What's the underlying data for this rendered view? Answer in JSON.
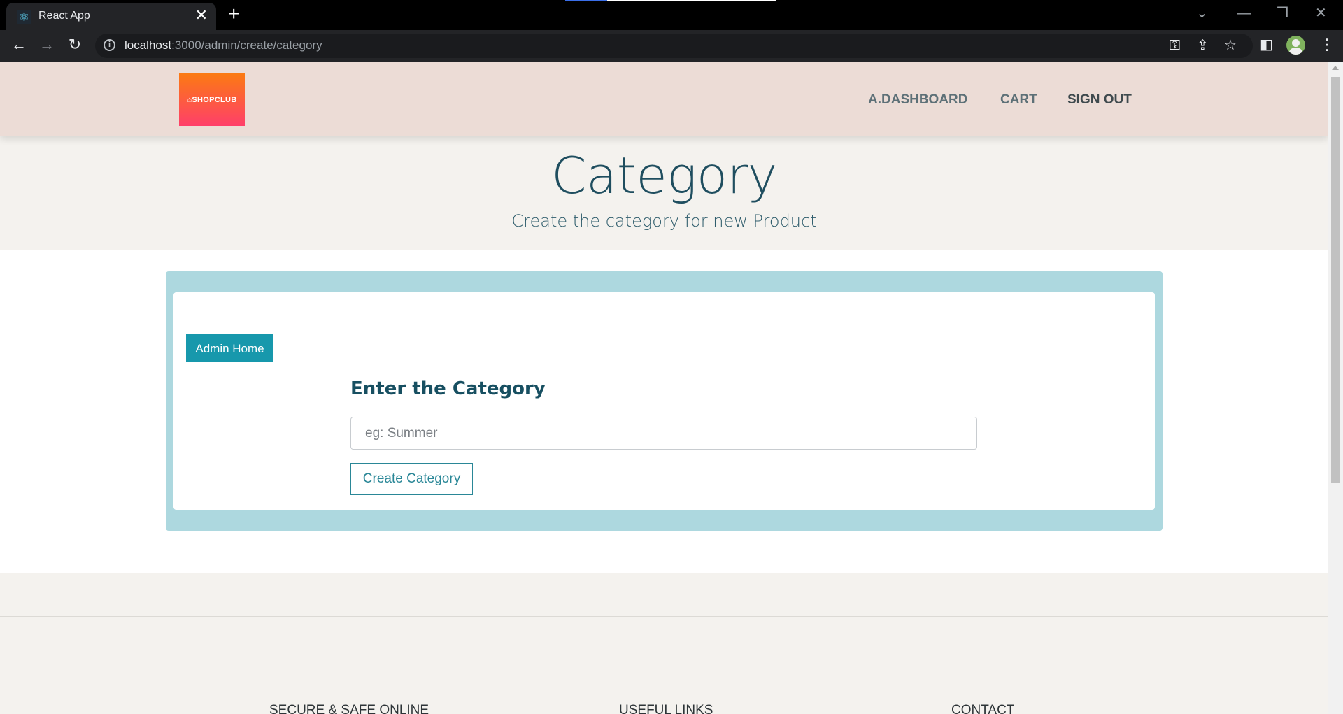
{
  "browser": {
    "tab_title": "React App",
    "url_host": "localhost",
    "url_path": ":3000/admin/create/category"
  },
  "header": {
    "logo_text": "SHOPCLUB",
    "nav": [
      "A.DASHBOARD",
      "CART",
      "SIGN OUT"
    ]
  },
  "hero": {
    "title": "Category",
    "subtitle": "Create the category for new Product"
  },
  "form": {
    "admin_home_label": "Admin Home",
    "heading": "Enter the Category",
    "input_placeholder": "eg: Summer",
    "input_value": "",
    "submit_label": "Create Category"
  },
  "footer": {
    "columns": [
      "SECURE & SAFE ONLINE",
      "USEFUL LINKS",
      "CONTACT"
    ]
  }
}
